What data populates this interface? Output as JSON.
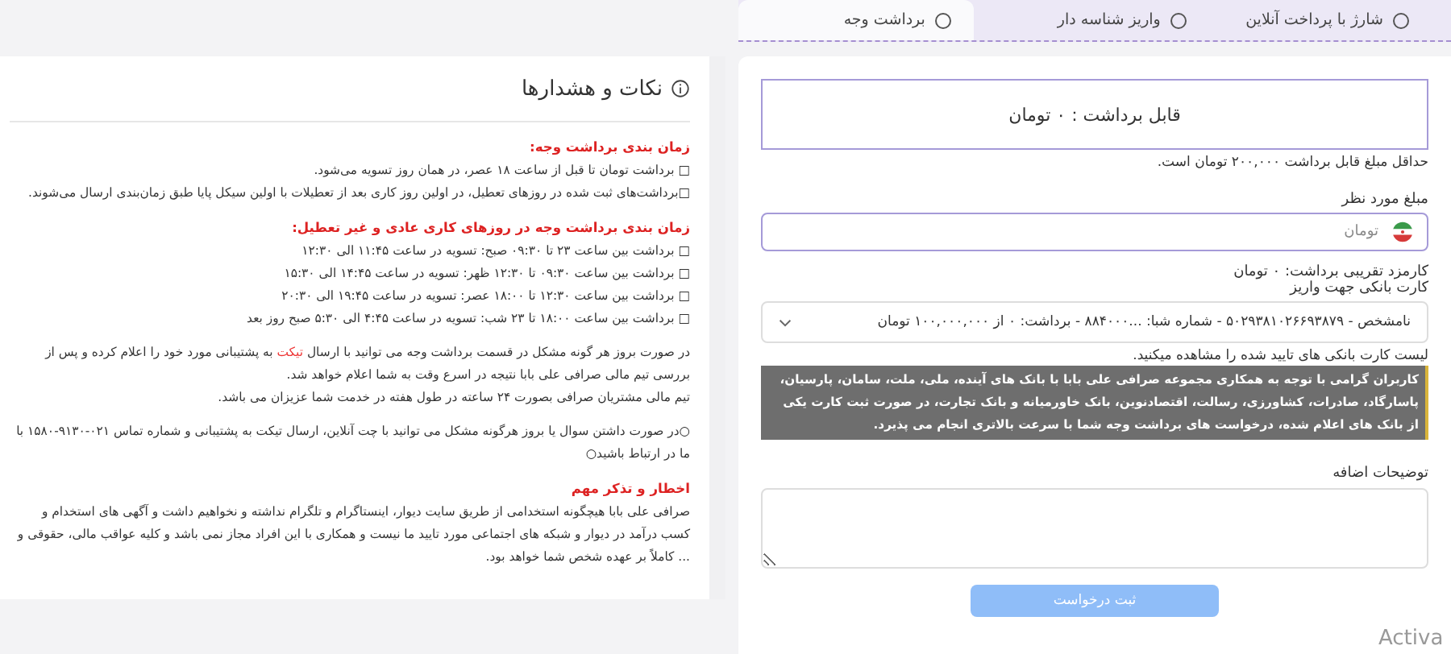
{
  "tabs": [
    {
      "label": "شارژ با پرداخت آنلاین",
      "selected": false
    },
    {
      "label": "واریز شناسه دار",
      "selected": false
    },
    {
      "label": "برداشت وجه",
      "selected": true
    }
  ],
  "withdraw": {
    "balance": "قابل برداشت : ۰ تومان",
    "min_note": "حداقل مبلغ قابل برداشت ۲۰۰,۰۰۰ تومان است.",
    "amount_label": "مبلغ مورد نظر",
    "amount_placeholder": "تومان",
    "fee": "کارمزد تقریبی برداشت: ۰ تومان",
    "card_label": "کارت بانکی جهت واریز",
    "card_value": "نامشخص - ۵۰۲۹۳۸۱۰۲۶۶۹۳۸۷۹ - شماره شبا: ...۸۸۴۰۰۰ - برداشت: ۰ از ۱۰۰,۰۰۰,۰۰۰ تومان",
    "card_hint": "لیست کارت بانکی های تایید شده را مشاهده میکنید.",
    "notice": "کاربران گرامی با توجه به همکاری مجموعه صرافی علی بابا با بانک های آینده، ملی، ملت، سامان، پارسیان، پاسارگاد، صادرات، کشاورزی، رسالت، اقتصادنوین، بانک خاورمیانه و بانک تجارت، در صورت ثبت کارت یکی از بانک های اعلام شده، درخواست های برداشت وجه شما با سرعت بالاتری انجام می پذیرد.",
    "notes_label": "توضیحات اضافه",
    "submit": {
      "label": "ثبت درخواست",
      "disabled": true
    }
  },
  "tips": {
    "title": "نکات و هشدارها",
    "blocks": [
      {
        "kind": "heading",
        "text": "زمان بندی برداشت وجه:"
      },
      {
        "kind": "line",
        "text": "□ برداشت تومان تا قبل از ساعت ۱۸ عصر، در همان روز تسویه می‌شود."
      },
      {
        "kind": "line",
        "text": "□برداشت‌های ثبت شده در روزهای تعطیل، در اولین روز کاری بعد از تعطیلات با اولین سیکل پایا طبق زمان‌بندی ارسال می‌شوند."
      },
      {
        "kind": "gap"
      },
      {
        "kind": "heading",
        "text": "زمان بندی برداشت وجه در روزهای کاری عادی و غیر تعطیل:"
      },
      {
        "kind": "line",
        "text": "□ برداشت بین ساعت ۲۳ تا ۰۹:۳۰ صبح: تسویه در ساعت ۱۱:۴۵ الی ۱۲:۳۰"
      },
      {
        "kind": "line",
        "text": "□ برداشت بین ساعت ۰۹:۳۰ تا ۱۲:۳۰ ظهر: تسویه در ساعت ۱۴:۴۵ الی ۱۵:۳۰"
      },
      {
        "kind": "line",
        "text": "□ برداشت بین ساعت ۱۲:۳۰ تا ۱۸:۰۰ عصر: تسویه در ساعت ۱۹:۴۵ الی ۲۰:۳۰"
      },
      {
        "kind": "line",
        "text": "□ برداشت بین ساعت ۱۸:۰۰ تا ۲۳ شب: تسویه در ساعت ۴:۴۵ الی ۵:۳۰ صبح روز بعد"
      },
      {
        "kind": "gap"
      },
      {
        "kind": "para",
        "parts": [
          {
            "text": "در صورت بروز هر گونه مشکل در قسمت برداشت وجه می توانید با ارسال "
          },
          {
            "text": "تیکت",
            "link": true
          },
          {
            "text": " به پشتیبانی مورد خود را اعلام کرده و پس از بررسی تیم مالی صرافی علی بابا نتیجه در اسرع وقت به شما اعلام خواهد شد."
          }
        ]
      },
      {
        "kind": "line",
        "text": "تیم مالی مشتریان صرافی بصورت ۲۴ ساعته در طول هفته در خدمت شما عزیزان می باشد."
      },
      {
        "kind": "gap"
      },
      {
        "kind": "line",
        "text": "○در صورت داشتن سوال یا بروز هرگونه مشکل می توانید با چت آنلاین، ارسال تیکت به پشتیبانی و شماره تماس ۰۲۱-۹۱۳۰-۱۵۸۰ با ما در ارتباط باشید○"
      },
      {
        "kind": "gap"
      },
      {
        "kind": "heading",
        "text": "اخطار و تذکر مهم"
      },
      {
        "kind": "line",
        "text": "صرافی علی بابا هیچگونه استخدامی از طریق سایت دیوار، اینستاگرام و تلگرام نداشته و نخواهیم داشت و آگهی های استخدام و کسب درآمد در دیوار و شبکه های اجتماعی مورد تایید ما نیست و همکاری با این افراد مجاز نمی باشد و کلیه عواقب مالی، حقوقی و ... کاملاً بر عهده شخص شما خواهد بود."
      }
    ]
  },
  "os_notice": "Activa"
}
